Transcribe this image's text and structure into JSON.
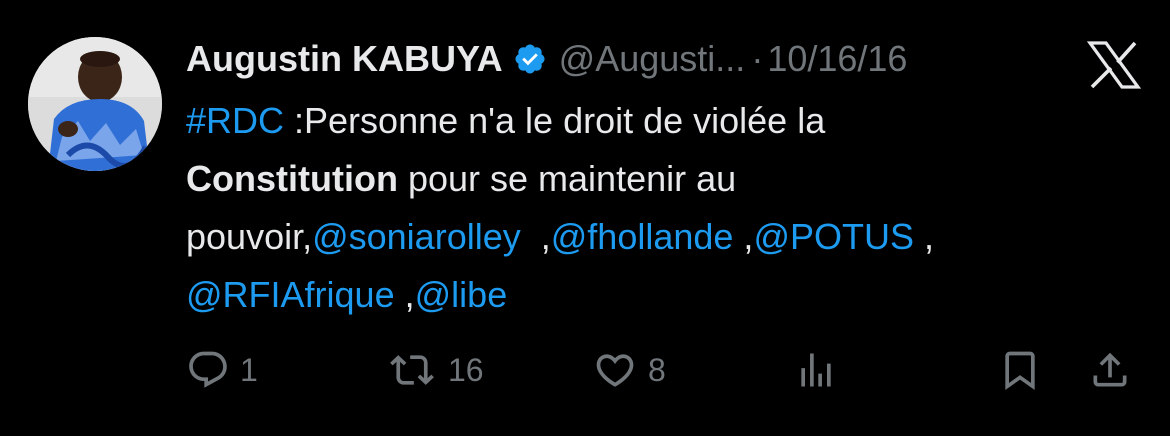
{
  "tweet": {
    "author_name": "Augustin KABUYA",
    "handle": "@Augusti...",
    "separator": "·",
    "date": "10/16/16",
    "text": {
      "hashtag": "#RDC",
      "line1_rest": " :Personne n'a le droit de violée la",
      "line2_bold": "Constitution",
      "line2_rest": " pour se maintenir au",
      "line3_prefix": "pouvoir,",
      "mention_1": "@soniarolley",
      "line3_sep1": "  ,",
      "mention_2": "@fhollande",
      "line3_sep2": " ,",
      "mention_3": "@POTUS",
      "line3_sep3": " ,",
      "mention_4": "@RFIAfrique",
      "line4_sep": " ,",
      "mention_5": "@libe"
    },
    "actions": {
      "replies": "1",
      "retweets": "16",
      "likes": "8"
    }
  },
  "colors": {
    "background": "#000000",
    "text": "#e7e9ea",
    "muted": "#71767b",
    "link": "#1d9bf0",
    "verified": "#1d9bf0"
  },
  "icons": {
    "verified": "verified-badge-icon",
    "x_logo": "x-logo-icon",
    "reply": "reply-icon",
    "retweet": "retweet-icon",
    "like": "heart-icon",
    "views": "views-icon",
    "bookmark": "bookmark-icon",
    "share": "share-icon"
  }
}
